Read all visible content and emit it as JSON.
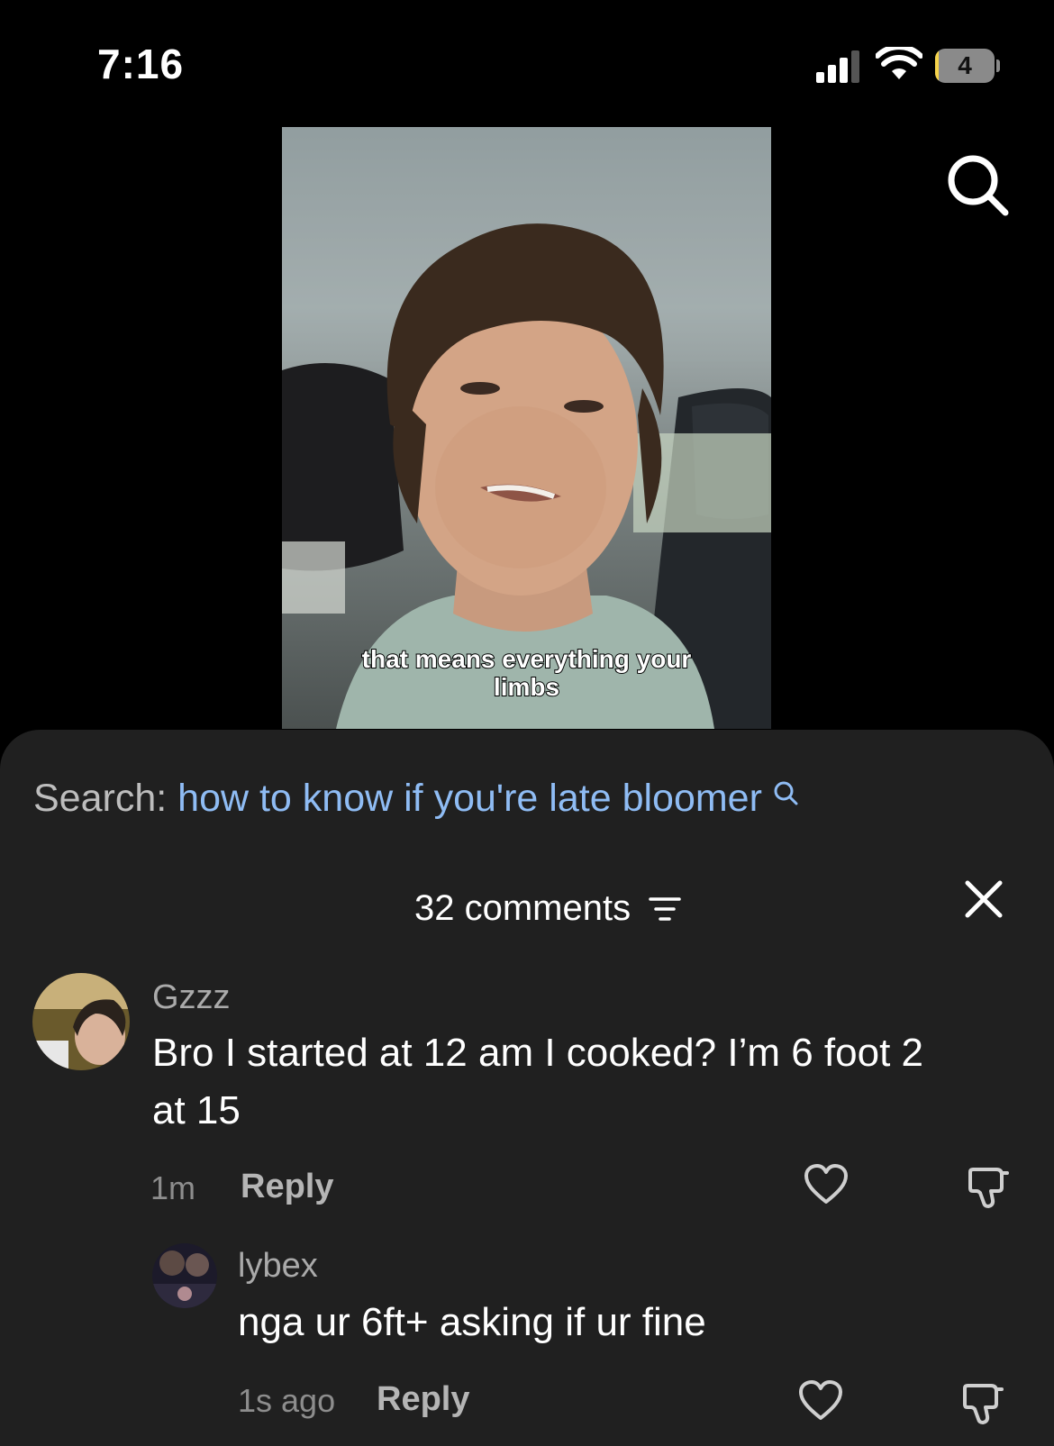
{
  "status_bar": {
    "time": "7:16",
    "battery_level": "4",
    "battery_fraction": 0.04
  },
  "video": {
    "caption_line1": "that means everything your",
    "caption_line2": "limbs"
  },
  "search_suggestion": {
    "label": "Search:",
    "query": "how to know if you're late bloomer"
  },
  "comments_header": {
    "count_label": "32 comments"
  },
  "comments": [
    {
      "username": "Gzzz",
      "text_line1": "Bro I started at 12 am I cooked? I’m 6 foot 2",
      "text_line2": "at 15",
      "time": "1m",
      "reply_label": "Reply",
      "replies": [
        {
          "username": "lybex",
          "text": "nga ur 6ft+ asking if ur fine",
          "time": "1s ago",
          "reply_label": "Reply"
        }
      ]
    }
  ],
  "colors": {
    "sheet_bg": "#202020",
    "search_query": "#8fbcf4",
    "battery_fill": "#f5d34a"
  }
}
